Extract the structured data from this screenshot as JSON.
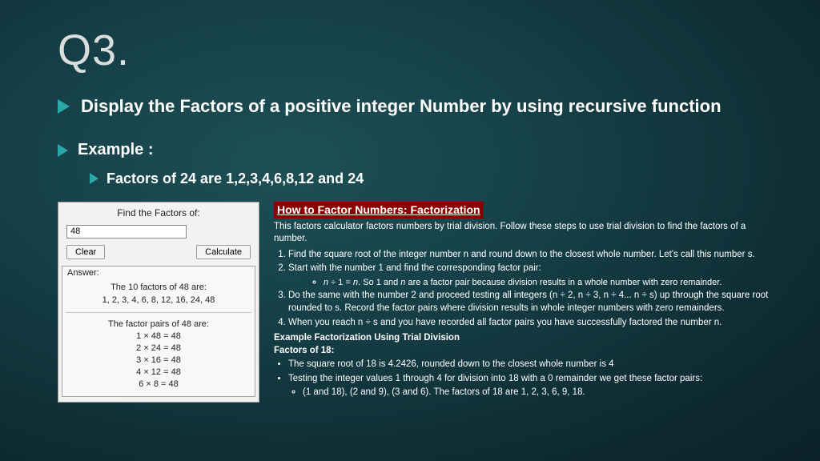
{
  "title": "Q3.",
  "bullet1": "Display the Factors of a positive integer Number by using recursive function",
  "bullet2": "Example :",
  "bullet3": "Factors of 24 are 1,2,3,4,6,8,12 and 24",
  "calc": {
    "heading": "Find the Factors of:",
    "value": "48",
    "clear": "Clear",
    "calculate": "Calculate",
    "answerLabel": "Answer:",
    "line1": "The 10 factors of 48 are:",
    "factors": "1, 2, 3, 4, 6, 8, 12, 16, 24, 48",
    "line2": "The factor pairs of 48 are:",
    "pairs": [
      "1 × 48 = 48",
      "2 × 24 = 48",
      "3 × 16 = 48",
      "4 × 12 = 48",
      "6 × 8 = 48"
    ]
  },
  "expl": {
    "heading": "How to Factor Numbers: Factorization",
    "intro": "This factors calculator factors numbers by trial division. Follow these steps to use trial division to find the factors of a number.",
    "steps": [
      "Find the square root of the integer number n and round down to the closest whole number. Let's call this number s.",
      "Start with the number 1 and find the corresponding factor pair:",
      "Do the same with the number 2 and proceed testing all integers (n ÷ 2, n ÷ 3, n ÷ 4... n ÷ s) up through the square root rounded to s. Record the factor pairs where division results in whole integer numbers with zero remainders.",
      "When you reach n ÷ s and you have recorded all factor pairs you have successfully factored the number n."
    ],
    "step2sub": "n ÷ 1 = n. So 1 and n are a factor pair because division results in a whole number with zero remainder.",
    "exTitle": "Example Factorization Using Trial Division",
    "exSub": "Factors of 18:",
    "ex1": "The square root of 18 is 4.2426, rounded down to the closest whole number is 4",
    "ex2": "Testing the integer values 1 through 4 for division into 18 with a 0 remainder we get these factor pairs:",
    "ex2sub": "(1 and 18), (2 and 9), (3 and 6). The factors of 18 are 1, 2, 3, 6, 9, 18."
  }
}
